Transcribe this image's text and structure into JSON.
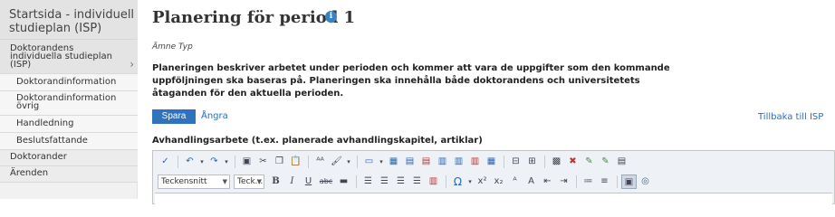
{
  "sidebar": {
    "header": "Startsida - individuell studieplan (ISP)",
    "items": [
      {
        "label": "Doktorandens individuella studieplan (ISP)"
      },
      {
        "label": "Doktorandinformation"
      },
      {
        "label": "Doktorandinformation övrig"
      },
      {
        "label": "Handledning"
      },
      {
        "label": "Beslutsfattande"
      },
      {
        "label": "Doktorander"
      },
      {
        "label": "Ärenden"
      }
    ]
  },
  "main": {
    "title": "Planering för period 1",
    "info_icon": "info-icon",
    "subject_type": "Ämne Typ",
    "description": "Planeringen beskriver arbetet under perioden och kommer att vara de uppgifter som den kommande uppföljningen ska baseras på. Planeringen ska innehålla både doktorandens och universitetets åtaganden för den aktuella perioden.",
    "save_label": "Spara",
    "undo_label": "Ångra",
    "back_label": "Tillbaka till ISP",
    "field_label": "Avhandlingsarbete (t.ex. planerade avhandlingskapitel, artiklar)"
  },
  "editor": {
    "font_family": "Teckensnitt",
    "font_size": "Teck...",
    "bold": "B",
    "italic": "I",
    "underline": "U",
    "strike": "abc",
    "omega": "Ω",
    "superscript": "x²",
    "subscript": "x₂"
  },
  "colors": {
    "accent": "#2f72c0",
    "link": "#2f6db5",
    "sidebar_bg": "#f1f1f1"
  }
}
